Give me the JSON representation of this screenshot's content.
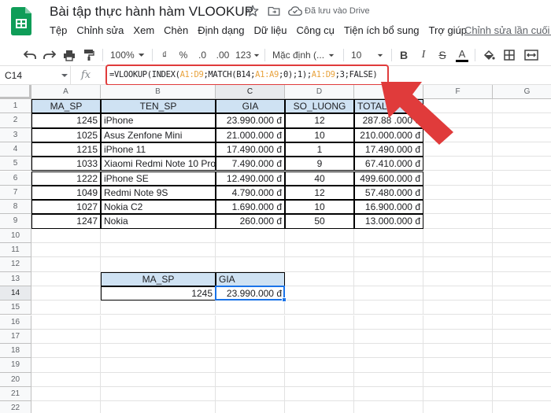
{
  "title_bar": {
    "doc_title": "Bài tập thực hành hàm VLOOKUP",
    "saved_status": "Đã lưu vào Drive",
    "last_edit": "Chỉnh sửa lần cuối v"
  },
  "menu": [
    "Tệp",
    "Chỉnh sửa",
    "Xem",
    "Chèn",
    "Định dạng",
    "Dữ liệu",
    "Công cụ",
    "Tiện ích bổ sung",
    "Trợ giúp"
  ],
  "toolbar": {
    "zoom": "100%",
    "currency": "₫",
    "percent": "%",
    "decimal_less": ".0",
    "decimal_more": ".00",
    "more_formats": "123",
    "font": "Mặc định (...",
    "font_size": "10",
    "bold": "B",
    "italic": "I",
    "strikethrough": "S",
    "text_color": "A"
  },
  "formula_bar": {
    "name_box": "C14",
    "fx": "fx",
    "parts": [
      "=VLOOKUP(INDEX(",
      "A1:D9",
      ";MATCH(B14;",
      "A1:A9",
      ";0);1);",
      "A1:D9",
      ";3;FALSE)"
    ]
  },
  "columns": [
    "A",
    "B",
    "C",
    "D",
    "E",
    "F",
    "G"
  ],
  "rows": [
    "1",
    "2",
    "3",
    "4",
    "5",
    "6",
    "7",
    "8",
    "9",
    "10",
    "11",
    "12",
    "13",
    "14",
    "15",
    "16",
    "17",
    "18",
    "19",
    "20",
    "21",
    "22"
  ],
  "table": {
    "headers": [
      "MA_SP",
      "TEN_SP",
      "GIA",
      "SO_LUONG",
      "TOTAL"
    ],
    "rows": [
      [
        "1245",
        "iPhone",
        "23.990.000 đ",
        "12",
        "287.88 .000 đ"
      ],
      [
        "1025",
        "Asus Zenfone Mini",
        "21.000.000 đ",
        "10",
        "210.000.000 đ"
      ],
      [
        "1215",
        "iPhone 11",
        "17.490.000 đ",
        "1",
        "17.490.000 đ"
      ],
      [
        "1033",
        "Xiaomi Redmi Note 10 Pro",
        "7.490.000 đ",
        "9",
        "67.410.000 đ"
      ],
      [
        "1222",
        "iPhone SE",
        "12.490.000 đ",
        "40",
        "499.600.000 đ"
      ],
      [
        "1049",
        "Redmi Note 9S",
        "4.790.000 đ",
        "12",
        "57.480.000 đ"
      ],
      [
        "1027",
        "Nokia C2",
        "1.690.000 đ",
        "10",
        "16.900.000 đ"
      ],
      [
        "1247",
        "Nokia",
        "260.000 đ",
        "50",
        "13.000.000 đ"
      ]
    ]
  },
  "lookup": {
    "header_ma_sp": "MA_SP",
    "header_gia": "GIA",
    "ma_sp": "1245",
    "gia": "23.990.000 đ"
  },
  "colors": {
    "header_fill": "#cfe2f3",
    "selection": "#1a73e8",
    "annotation_red": "#e03b3b",
    "range_ref": "#e8a23c"
  }
}
